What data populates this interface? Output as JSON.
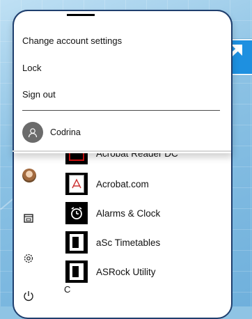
{
  "account_menu": {
    "items": [
      {
        "label": "Change account settings"
      },
      {
        "label": "Lock"
      },
      {
        "label": "Sign out"
      }
    ],
    "user": {
      "name": "Codrina"
    }
  },
  "apps": [
    {
      "label": "Acrobat Reader DC"
    },
    {
      "label": "Acrobat.com"
    },
    {
      "label": "Alarms & Clock"
    },
    {
      "label": "aSc Timetables"
    },
    {
      "label": "ASRock Utility"
    }
  ],
  "next_group_letter": "C",
  "icons": {
    "expand": "expand-arrows-icon",
    "documents": "documents-icon",
    "settings": "gear-icon",
    "power": "power-icon",
    "user": "user-silhouette-icon"
  }
}
